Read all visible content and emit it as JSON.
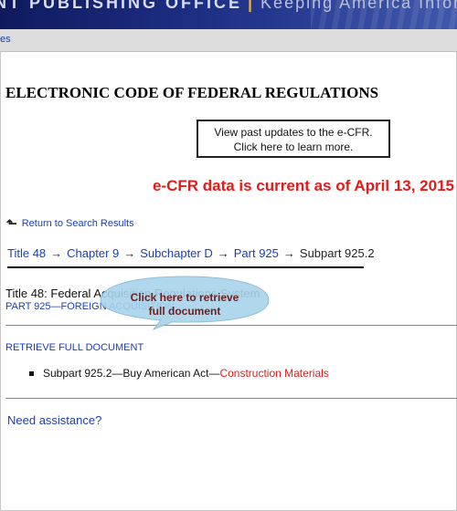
{
  "banner": {
    "title": "NT PUBLISHING OFFICE",
    "separator": "|",
    "tagline": "Keeping America Informed"
  },
  "navbar": {
    "link": "es"
  },
  "page": {
    "title": "ELECTRONIC CODE OF FEDERAL REGULATIONS"
  },
  "updates_box": {
    "line1": "View past updates to the e-CFR.",
    "line2": "Click here to learn more."
  },
  "current_status": "e-CFR data is current as of April 13, 2015",
  "return_link": "Return to Search Results",
  "breadcrumb": {
    "items": [
      "Title 48",
      "Chapter 9",
      "Subchapter D",
      "Part 925"
    ],
    "current": "Subpart 925.2",
    "separator": "→"
  },
  "title_line": "Title 48: Federal Acquisition Regulations System",
  "part_line": "PART 925—FOREIGN ACQUISITION",
  "retrieve_link": "RETRIEVE FULL DOCUMENT",
  "subpart": {
    "prefix": "Subpart 925.2—Buy American Act—",
    "link": "Construction Materials"
  },
  "assistance_link": "Need assistance?",
  "callout": {
    "line1": "Click here to retrieve",
    "line2": "full document",
    "fill": "#a9d3ea"
  },
  "colors": {
    "link_blue": "#1a3fb0",
    "alert_red": "#e21b1b",
    "banner_navy": "#1e2f86"
  }
}
